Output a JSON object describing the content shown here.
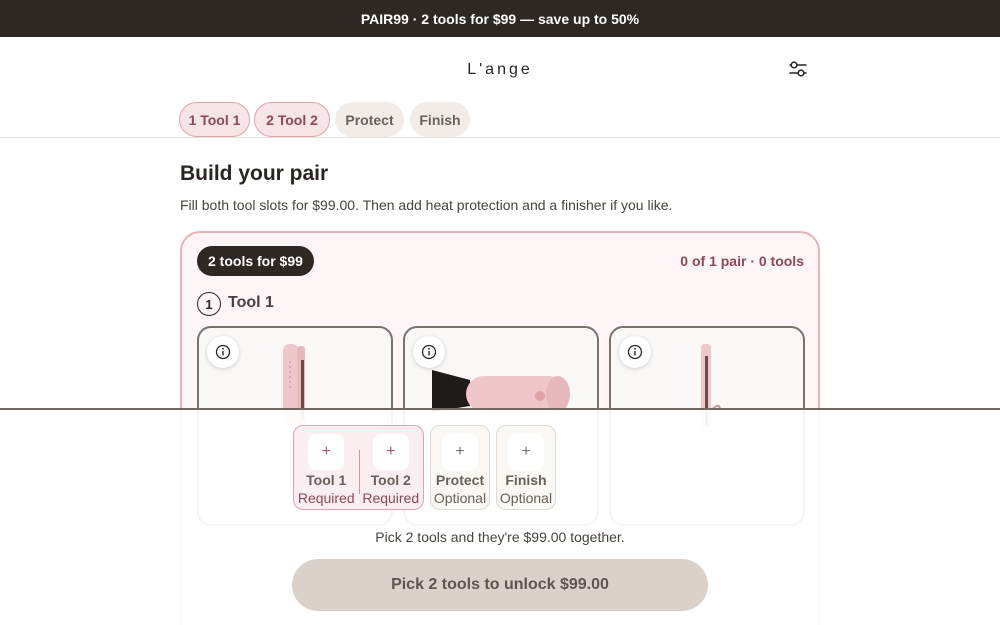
{
  "promo": {
    "text": "PAIR99 · 2 tools for $99 — save up to 50%"
  },
  "header": {
    "logo": "L'ange",
    "filter_icon": "sliders-icon"
  },
  "steps": [
    {
      "label": "1 Tool 1",
      "state": "active"
    },
    {
      "label": "2 Tool 2",
      "state": "active"
    },
    {
      "label": "Protect",
      "state": "inactive"
    },
    {
      "label": "Finish",
      "state": "inactive"
    }
  ],
  "main": {
    "title": "Build your pair",
    "subtitle": "Fill both tool slots for $99.00. Then add heat protection and a finisher if you like."
  },
  "pair_card": {
    "badge": "2 tools for $99",
    "progress": "0 of 1 pair · 0 tools",
    "slot_number": "1",
    "slot_label": "Tool 1",
    "products": [
      {
        "icon": "flat-iron-icon",
        "info_icon": "info-icon"
      },
      {
        "icon": "hair-dryer-icon",
        "info_icon": "info-icon"
      },
      {
        "icon": "curling-wand-icon",
        "info_icon": "info-icon"
      }
    ]
  },
  "tray": {
    "slots": [
      {
        "plus": "+",
        "name": "Tool 1",
        "status": "Required"
      },
      {
        "plus": "+",
        "name": "Tool 2",
        "status": "Required"
      },
      {
        "plus": "+",
        "name": "Protect",
        "status": "Optional"
      },
      {
        "plus": "+",
        "name": "Finish",
        "status": "Optional"
      }
    ],
    "hint": "Pick 2 tools and they're $99.00 together.",
    "cta": "Pick 2 tools to unlock $99.00"
  },
  "colors": {
    "promo_bg": "#2e2824",
    "accent_pink": "#dca5ad",
    "accent_text": "#8a4a56",
    "cta_bg": "#d9d1ca"
  }
}
